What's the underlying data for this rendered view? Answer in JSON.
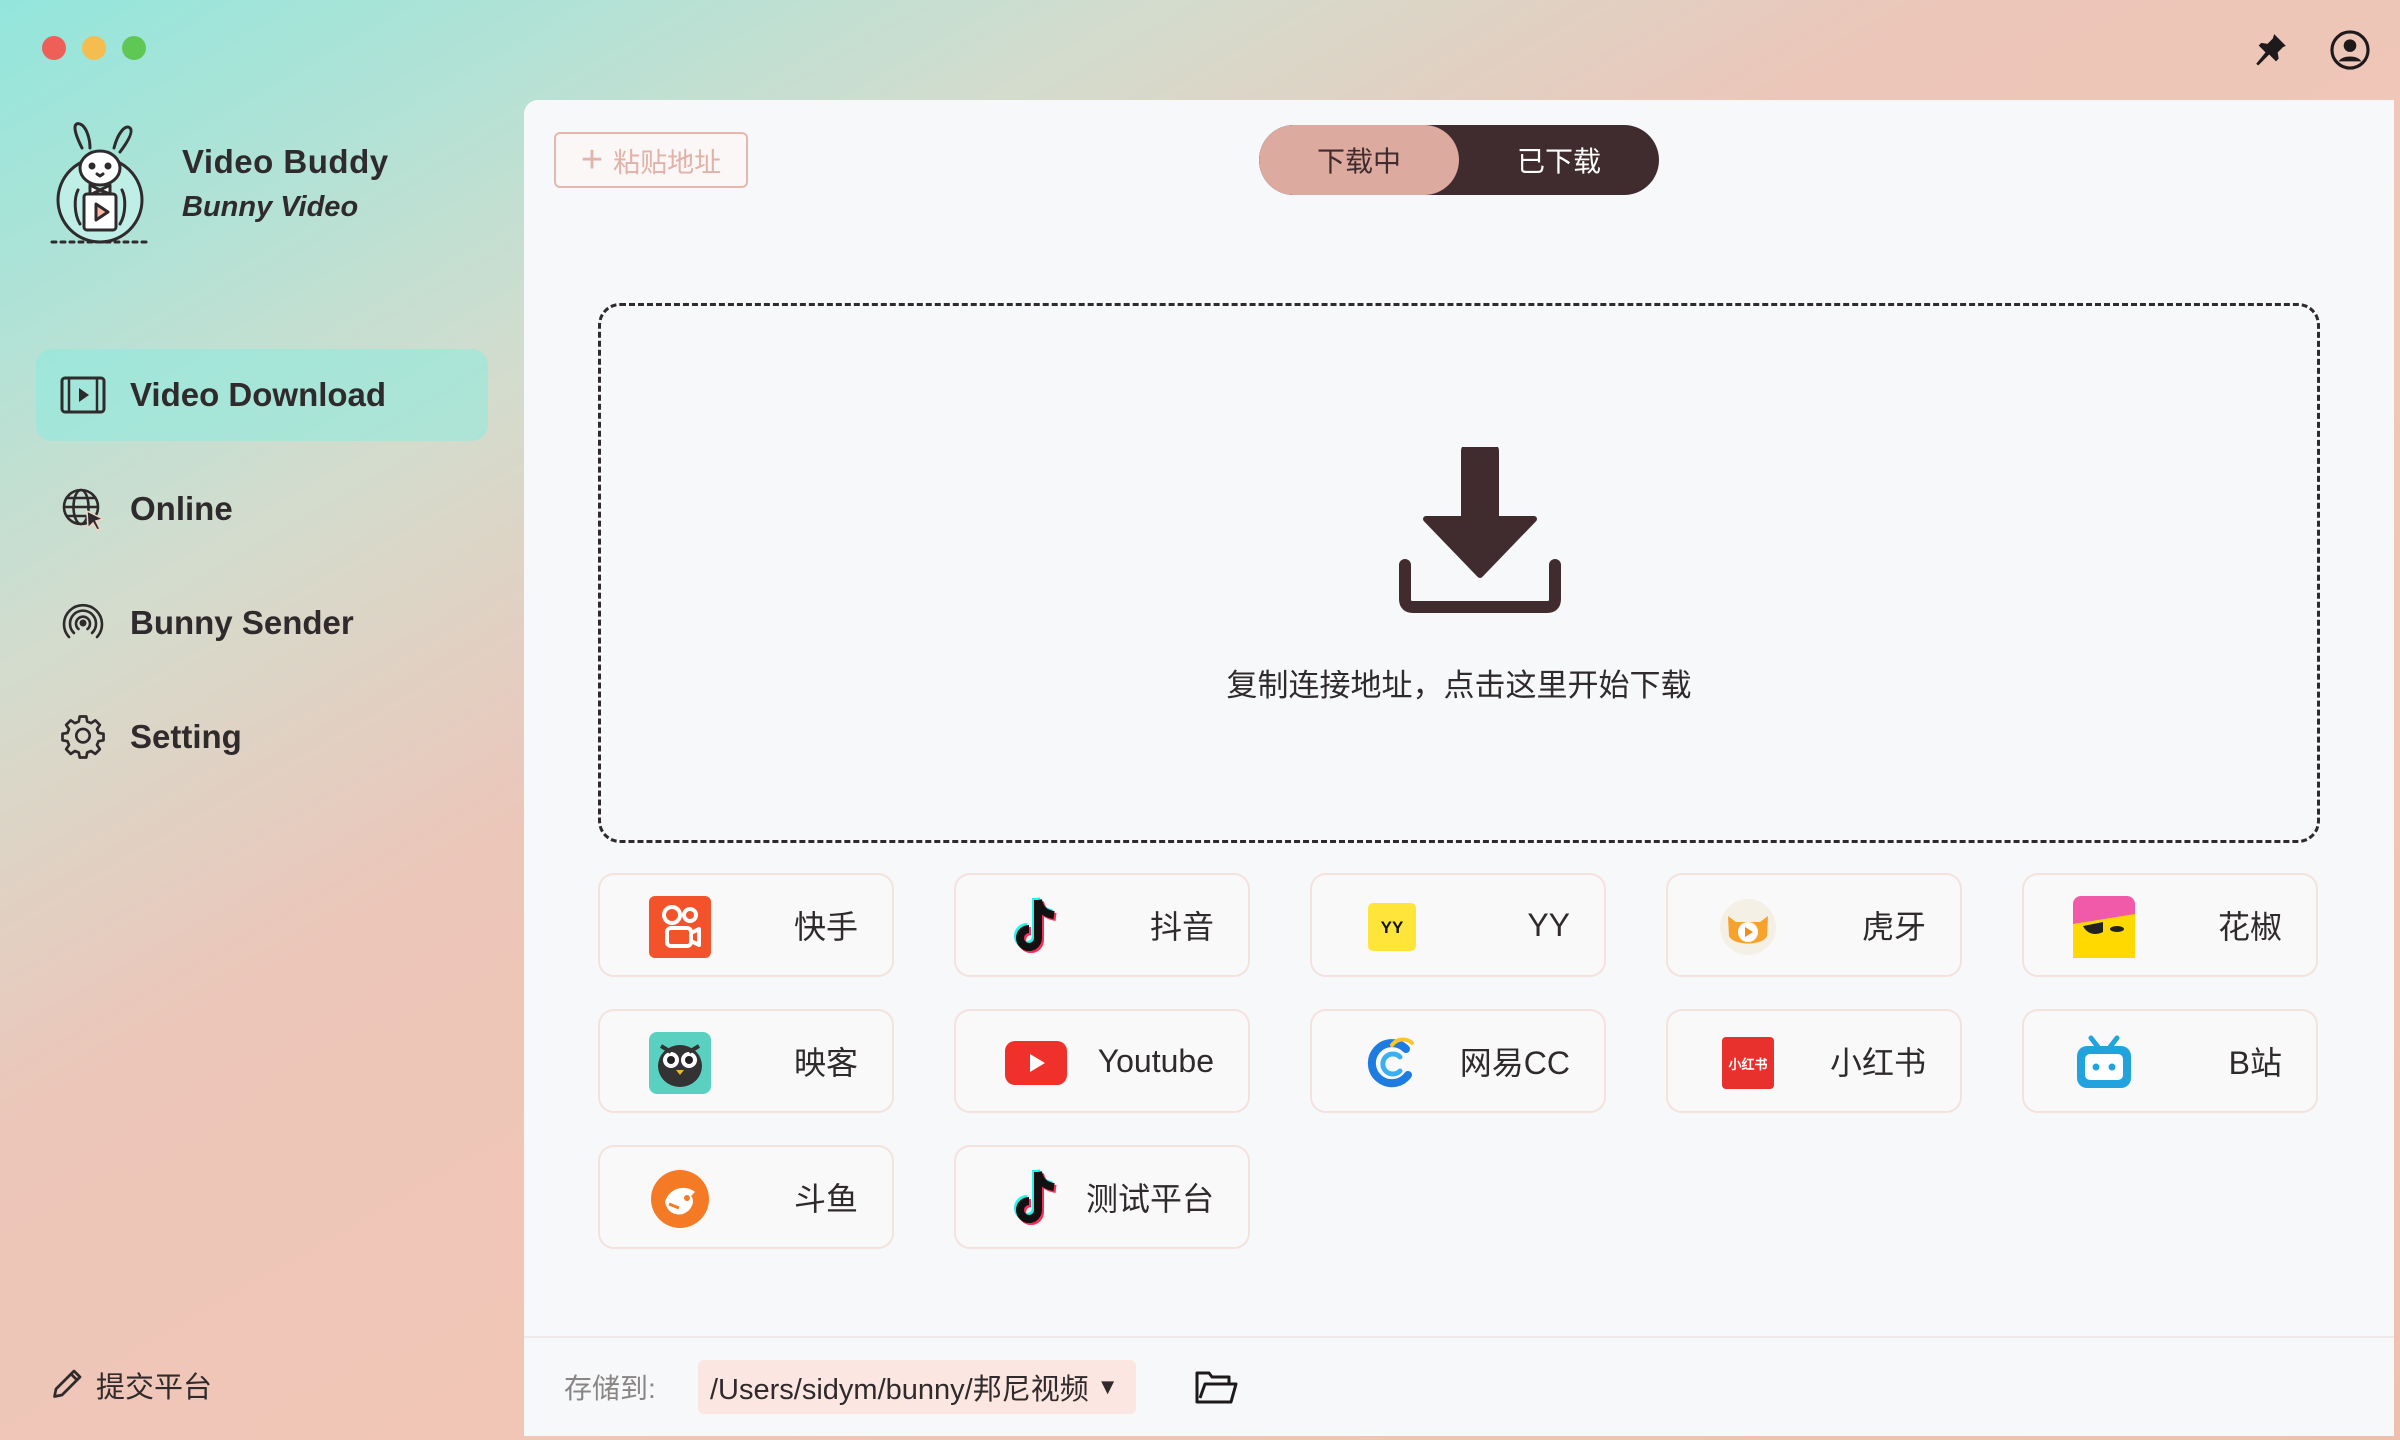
{
  "app": {
    "title": "Video Buddy",
    "subtitle": "Bunny Video"
  },
  "window_controls": [
    "close-icon",
    "minimize-icon",
    "maximize-icon"
  ],
  "top_icons": [
    "pin-icon",
    "user-icon"
  ],
  "sidebar": {
    "items": [
      {
        "label": "Video Download",
        "icon": "video-icon",
        "active": true
      },
      {
        "label": "Online",
        "icon": "globe-cursor-icon",
        "active": false
      },
      {
        "label": "Bunny Sender",
        "icon": "signal-icon",
        "active": false
      },
      {
        "label": "Setting",
        "icon": "gear-icon",
        "active": false
      }
    ],
    "submit_label": "提交平台"
  },
  "toolbar": {
    "paste_label": "粘贴地址",
    "tabs": [
      {
        "label": "下载中",
        "active": true
      },
      {
        "label": "已下载",
        "active": false
      }
    ]
  },
  "dropzone": {
    "hint": "复制连接地址，点击这里开始下载"
  },
  "platforms": [
    {
      "label": "快手",
      "icon": "kuaishou-icon"
    },
    {
      "label": "抖音",
      "icon": "douyin-icon"
    },
    {
      "label": "YY",
      "icon": "yy-icon",
      "icon_text": "YY"
    },
    {
      "label": "虎牙",
      "icon": "huya-icon"
    },
    {
      "label": "花椒",
      "icon": "huajiao-icon"
    },
    {
      "label": "映客",
      "icon": "inke-icon"
    },
    {
      "label": "Youtube",
      "icon": "youtube-icon"
    },
    {
      "label": "网易CC",
      "icon": "netease-cc-icon"
    },
    {
      "label": "小红书",
      "icon": "xiaohongshu-icon",
      "icon_text": "小红书"
    },
    {
      "label": "B站",
      "icon": "bilibili-icon"
    },
    {
      "label": "斗鱼",
      "icon": "douyu-icon"
    },
    {
      "label": "测试平台",
      "icon": "douyin-icon"
    }
  ],
  "footer": {
    "save_label": "存储到:",
    "path": "/Users/sidym/bunny/邦尼视频"
  },
  "colors": {
    "accent_dark": "#402c2e",
    "accent_pink": "#ddaaa0",
    "active_nav": "#8cebde"
  }
}
